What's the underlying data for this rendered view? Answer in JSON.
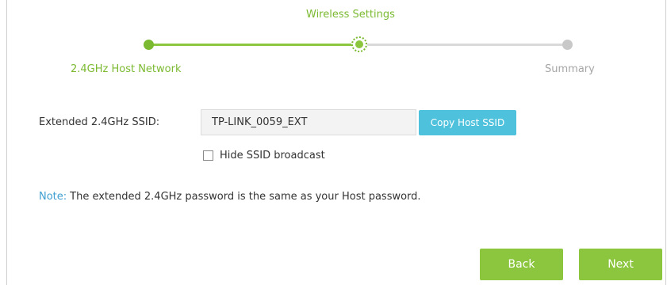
{
  "wizard": {
    "title": "Wireless Settings",
    "steps": [
      {
        "label": "2.4GHz Host Network",
        "state": "done"
      },
      {
        "label": "",
        "state": "current"
      },
      {
        "label": "Summary",
        "state": "pending"
      }
    ]
  },
  "form": {
    "ssid_label": "Extended 2.4GHz SSID:",
    "ssid_value": "TP-LINK_0059_EXT",
    "copy_button": "Copy Host SSID",
    "hide_ssid_label": "Hide SSID broadcast",
    "hide_ssid_checked": false
  },
  "note": {
    "prefix": "Note:",
    "text": "The extended 2.4GHz password is the same as your Host password."
  },
  "actions": {
    "back": "Back",
    "next": "Next"
  },
  "colors": {
    "accent_green": "#8cc63e",
    "accent_blue": "#4ec1dc",
    "note_blue": "#3f9fd0",
    "inactive_gray": "#c8c8c8"
  },
  "icons": {
    "step_done": "filled-circle",
    "step_current": "dotted-ring-circle",
    "step_pending": "gray-circle",
    "checkbox": "empty-square"
  }
}
